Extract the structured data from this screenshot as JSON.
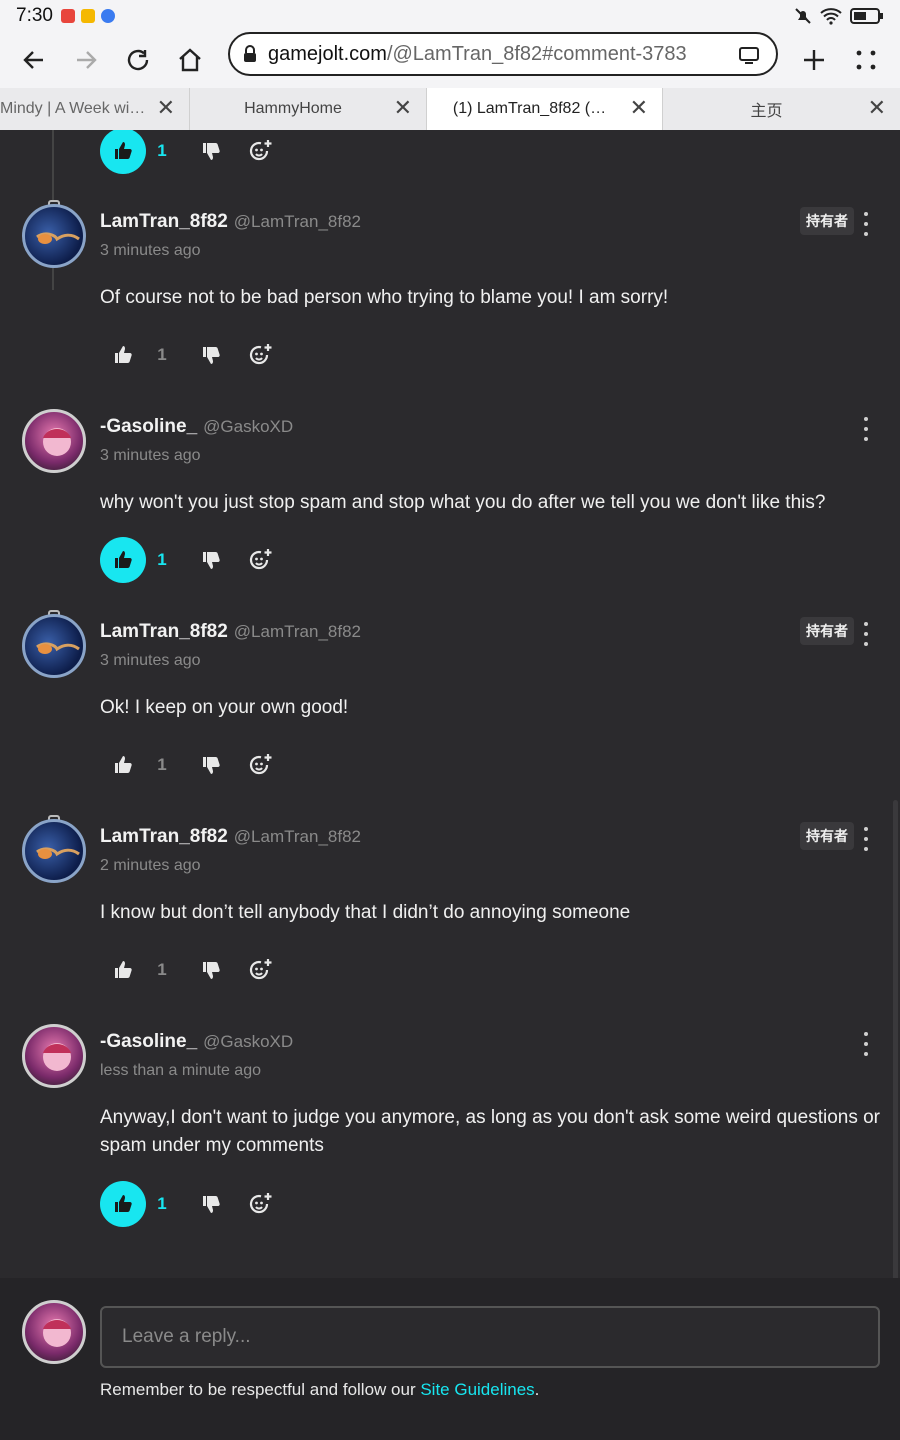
{
  "status_bar": {
    "time": "7:30"
  },
  "browser": {
    "url_domain": "gamejolt.com",
    "url_path": "/@LamTran_8f82#comment-3783",
    "tabs": [
      {
        "label": "Mindy | A Week wi…",
        "active": false
      },
      {
        "label": "HammyHome",
        "active": false
      },
      {
        "label": "(1) LamTran_8f82 (…",
        "active": true
      },
      {
        "label": "主页",
        "active": false
      }
    ]
  },
  "top_action_row": {
    "like_count": "1",
    "liked": true
  },
  "comments": [
    {
      "name": "LamTran_8f82",
      "handle": "@LamTran_8f82",
      "time": "3 minutes ago",
      "badge": "持有者",
      "text": "Of course not to be bad person who trying to blame you! I am sorry!",
      "likes": "1",
      "liked": false,
      "avatar": "jellyfish-avatar"
    },
    {
      "name": "-Gasoline_",
      "handle": "@GaskoXD",
      "time": "3 minutes ago",
      "badge": "",
      "text": "why won't you just stop spam and stop what you do after we tell you we don't like this?",
      "likes": "1",
      "liked": true,
      "avatar": "anime-avatar"
    },
    {
      "name": "LamTran_8f82",
      "handle": "@LamTran_8f82",
      "time": "3 minutes ago",
      "badge": "持有者",
      "text": "Ok! I keep on your own good!",
      "likes": "1",
      "liked": false,
      "avatar": "jellyfish-avatar"
    },
    {
      "name": "LamTran_8f82",
      "handle": "@LamTran_8f82",
      "time": "2 minutes ago",
      "badge": "持有者",
      "text": "I know but don’t tell anybody that I didn’t do annoying someone",
      "likes": "1",
      "liked": false,
      "avatar": "jellyfish-avatar"
    },
    {
      "name": "-Gasoline_",
      "handle": "@GaskoXD",
      "time": "less than a minute ago",
      "badge": "",
      "text": "Anyway,I don't want to judge you anymore, as long as you don't ask some weird questions or spam under my comments",
      "likes": "1",
      "liked": true,
      "avatar": "anime-avatar"
    }
  ],
  "reply_box": {
    "placeholder": "Leave a reply...",
    "guideline_prefix": "Remember to be respectful and follow our ",
    "guideline_link": "Site Guidelines",
    "guideline_suffix": "."
  },
  "colors": {
    "accent": "#18e6f0",
    "background": "#2b2a2d"
  }
}
